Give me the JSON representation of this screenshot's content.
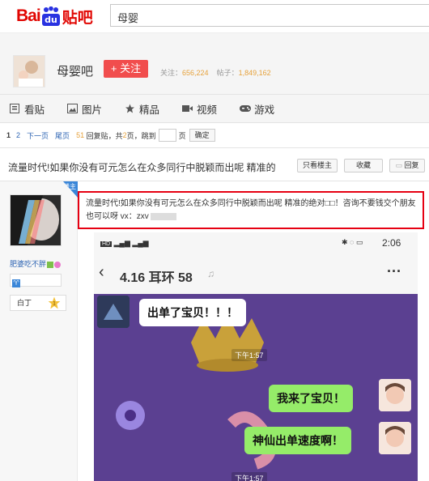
{
  "header": {
    "logo_text_1": "Bai",
    "logo_text_2": "贴吧",
    "search_value": "母婴"
  },
  "forum": {
    "name": "母婴吧",
    "follow_label": "+ 关注",
    "follow_stat_label": "关注：",
    "follow_count": "656,224",
    "posts_stat_label": "帖子：",
    "posts_count": "1,849,162"
  },
  "nav": {
    "items": [
      {
        "label": "看贴",
        "icon": "list-icon"
      },
      {
        "label": "图片",
        "icon": "image-icon"
      },
      {
        "label": "精品",
        "icon": "star-icon"
      },
      {
        "label": "视频",
        "icon": "video-icon"
      },
      {
        "label": "游戏",
        "icon": "gamepad-icon"
      }
    ]
  },
  "pager": {
    "current": "1",
    "page2": "2",
    "next": "下一页",
    "last": "尾页",
    "reply_count": "51",
    "reply_text": "回复贴，共",
    "total_pages": "2",
    "pages_text": "页，跳到",
    "page_unit": "页",
    "confirm": "确定"
  },
  "thread": {
    "title": "流量时代!如果你没有可元怎么在众多同行中脱颖而出呢 精准的",
    "only_op": "只看楼主",
    "collect": "收藏",
    "reply": "回复"
  },
  "post": {
    "badge": "楼主",
    "username": "肥婆吃不胖",
    "level_title": "白丁",
    "level_num": "1",
    "content": "流量时代!如果你没有可元怎么在众多同行中脱颖而出呢 精准的绝对□□！咨询不要钱交个朋友也可以呀 vx：zxv"
  },
  "screenshot": {
    "signal": "HD",
    "time": "2:06",
    "chat_title": "4.16 耳环 58",
    "messages": [
      {
        "from": "other",
        "text": "出单了宝贝！！！"
      },
      {
        "from": "me",
        "text": "我来了宝贝！"
      },
      {
        "from": "me",
        "text": "神仙出单速度啊！"
      }
    ],
    "timestamps": [
      "下午1:57",
      "下午1:57"
    ]
  },
  "colors": {
    "brand_red": "#e10602",
    "follow_red": "#f14d4d",
    "link_blue": "#2d64b3",
    "wechat_green": "#95ec69",
    "highlight_border": "#e60012"
  }
}
